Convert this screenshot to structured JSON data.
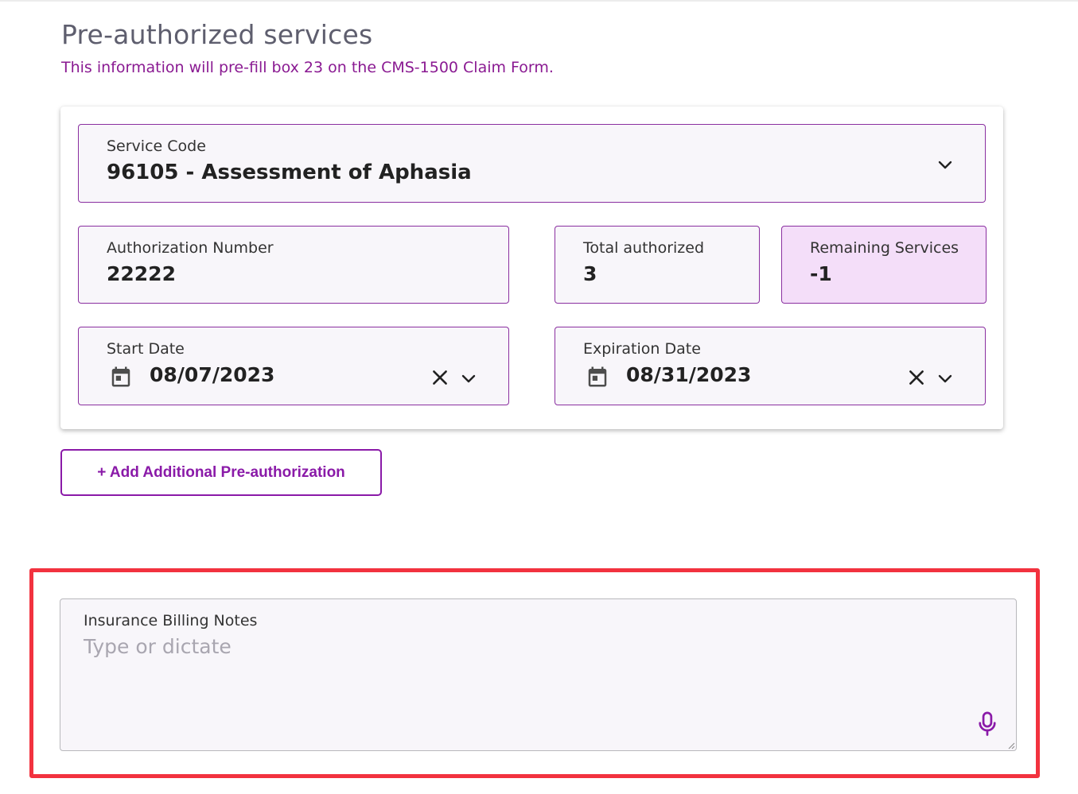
{
  "section": {
    "title": "Pre-authorized services",
    "subtitle": "This information will pre-fill box 23 on the CMS-1500 Claim Form."
  },
  "service_code": {
    "label": "Service Code",
    "value": "96105 - Assessment of Aphasia"
  },
  "authorization_number": {
    "label": "Authorization Number",
    "value": "22222"
  },
  "total_authorized": {
    "label": "Total authorized",
    "value": "3"
  },
  "remaining_services": {
    "label": "Remaining Services",
    "value": "-1"
  },
  "start_date": {
    "label": "Start Date",
    "value": "08/07/2023"
  },
  "expiration_date": {
    "label": "Expiration Date",
    "value": "08/31/2023"
  },
  "add_button": {
    "label": "+ Add Additional Pre-authorization"
  },
  "billing_notes": {
    "label": "Insurance Billing Notes",
    "placeholder": "Type or dictate"
  },
  "icons": {
    "calendar": "calendar-icon",
    "clear": "close-icon",
    "dropdown": "chevron-down-icon",
    "dictate": "microphone-icon"
  },
  "colors": {
    "accent": "#8a1aa8",
    "subtitle": "#8a1a92",
    "field_border": "#8a2fa0",
    "highlight_field": "#f4def9",
    "annotation_box": "#f2323f"
  }
}
